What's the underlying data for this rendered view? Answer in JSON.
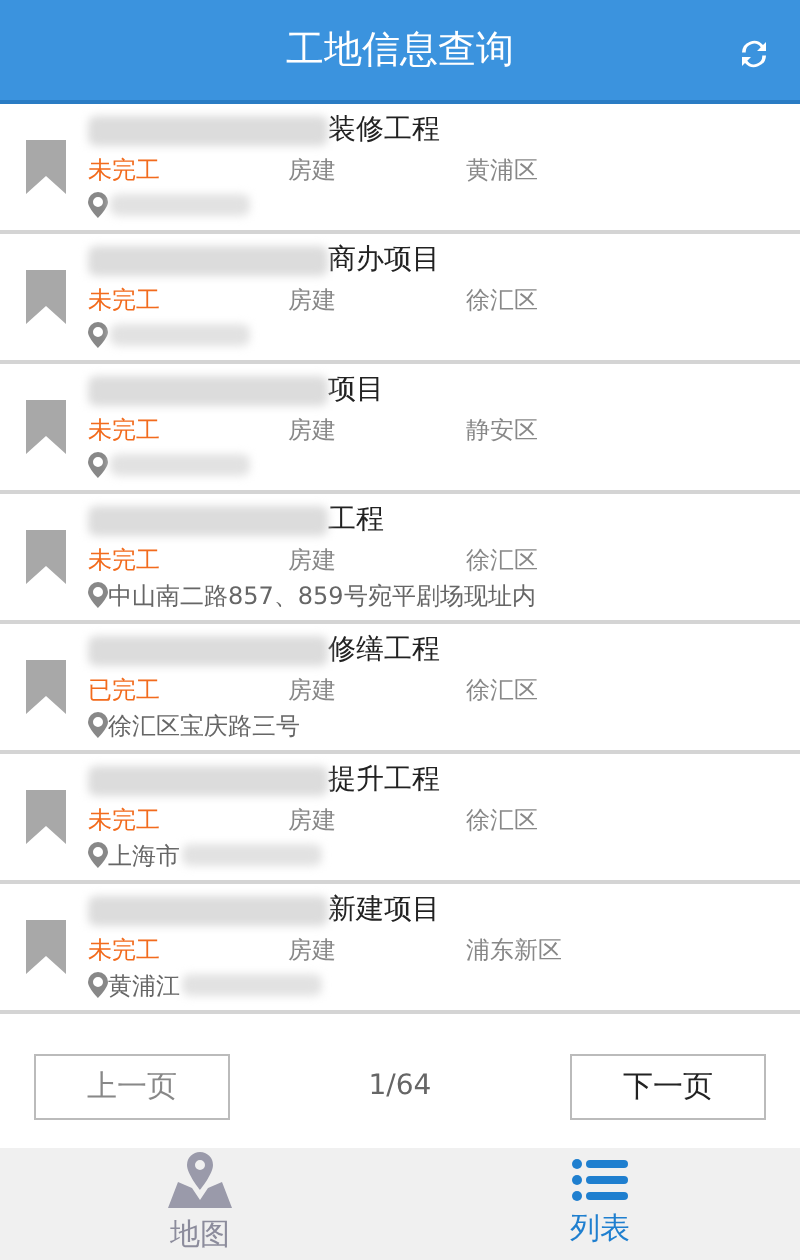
{
  "header": {
    "title": "工地信息查询"
  },
  "rows": [
    {
      "title": "装修工程",
      "title_redacted": true,
      "status": "未完工",
      "type": "房建",
      "district": "黄浦区",
      "address": "",
      "address_redacted": true
    },
    {
      "title": "商办项目",
      "title_redacted": true,
      "status": "未完工",
      "type": "房建",
      "district": "徐汇区",
      "address": "",
      "address_redacted": true
    },
    {
      "title": "项目",
      "title_redacted": true,
      "status": "未完工",
      "type": "房建",
      "district": "静安区",
      "address": "",
      "address_redacted": true
    },
    {
      "title": "工程",
      "title_redacted": true,
      "status": "未完工",
      "type": "房建",
      "district": "徐汇区",
      "address": "中山南二路857、859号宛平剧场现址内",
      "address_redacted": false
    },
    {
      "title": "修缮工程",
      "title_redacted": true,
      "status": "已完工",
      "type": "房建",
      "district": "徐汇区",
      "address": "徐汇区宝庆路三号",
      "address_redacted": false
    },
    {
      "title": "提升工程",
      "title_redacted": true,
      "status": "未完工",
      "type": "房建",
      "district": "徐汇区",
      "address": "上海市",
      "address_redacted": true
    },
    {
      "title": "新建项目",
      "title_redacted": true,
      "status": "未完工",
      "type": "房建",
      "district": "浦东新区",
      "address": "黄浦江",
      "address_redacted": true
    }
  ],
  "pager": {
    "prev": "上一页",
    "page": "1/64",
    "next": "下一页"
  },
  "tabs": [
    {
      "label": "地图",
      "kind": "map",
      "selected": false
    },
    {
      "label": "列表",
      "kind": "list",
      "selected": true
    }
  ]
}
